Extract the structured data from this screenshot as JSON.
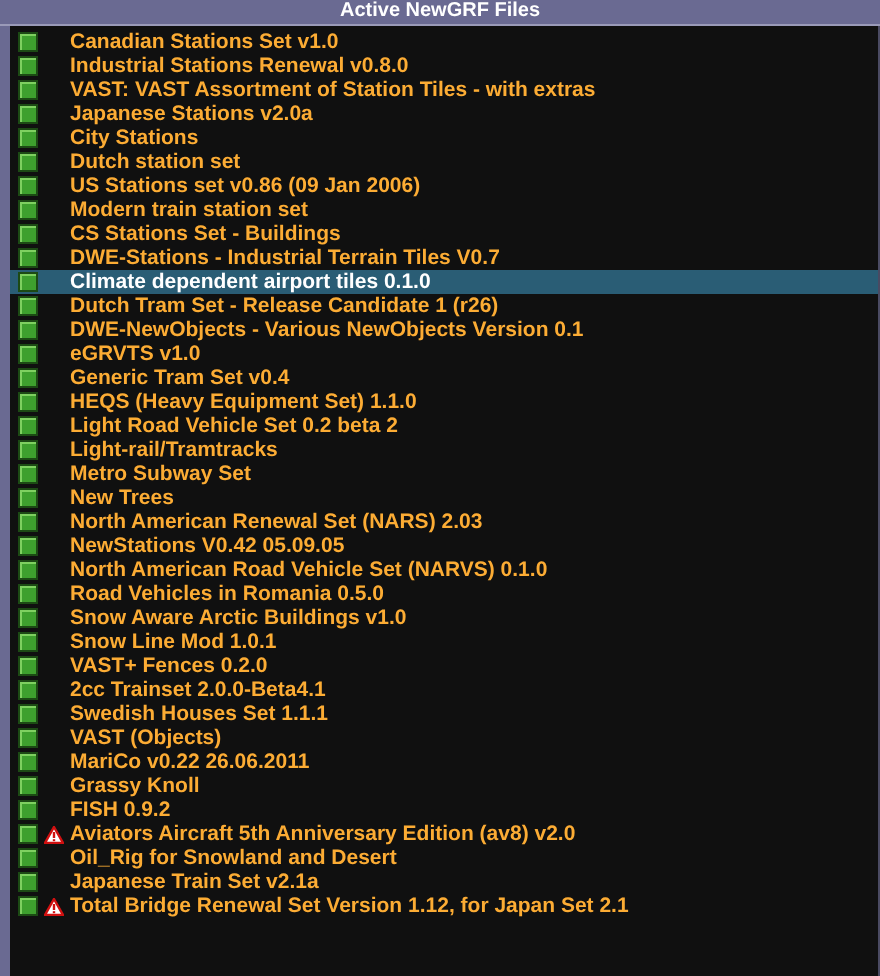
{
  "window": {
    "title": "Active NewGRF Files"
  },
  "items": [
    {
      "label": "Canadian Stations Set v1.0",
      "selected": false,
      "warning": false
    },
    {
      "label": "Industrial Stations Renewal v0.8.0",
      "selected": false,
      "warning": false
    },
    {
      "label": "VAST: VAST Assortment of Station Tiles - with extras",
      "selected": false,
      "warning": false
    },
    {
      "label": "Japanese Stations v2.0a",
      "selected": false,
      "warning": false
    },
    {
      "label": "City Stations",
      "selected": false,
      "warning": false
    },
    {
      "label": "Dutch station set",
      "selected": false,
      "warning": false
    },
    {
      "label": "US Stations set v0.86 (09 Jan 2006)",
      "selected": false,
      "warning": false
    },
    {
      "label": "Modern train station set",
      "selected": false,
      "warning": false
    },
    {
      "label": "CS Stations Set - Buildings",
      "selected": false,
      "warning": false
    },
    {
      "label": "DWE-Stations - Industrial Terrain Tiles V0.7",
      "selected": false,
      "warning": false
    },
    {
      "label": "Climate dependent airport tiles 0.1.0",
      "selected": true,
      "warning": false
    },
    {
      "label": "Dutch Tram Set - Release Candidate 1 (r26)",
      "selected": false,
      "warning": false
    },
    {
      "label": "DWE-NewObjects - Various NewObjects Version 0.1",
      "selected": false,
      "warning": false
    },
    {
      "label": "eGRVTS v1.0",
      "selected": false,
      "warning": false
    },
    {
      "label": "Generic Tram Set v0.4",
      "selected": false,
      "warning": false
    },
    {
      "label": "HEQS (Heavy Equipment Set) 1.1.0",
      "selected": false,
      "warning": false
    },
    {
      "label": "Light Road Vehicle Set 0.2 beta 2",
      "selected": false,
      "warning": false
    },
    {
      "label": "Light-rail/Tramtracks",
      "selected": false,
      "warning": false
    },
    {
      "label": "Metro Subway Set",
      "selected": false,
      "warning": false
    },
    {
      "label": "New Trees",
      "selected": false,
      "warning": false
    },
    {
      "label": "North American Renewal Set (NARS) 2.03",
      "selected": false,
      "warning": false
    },
    {
      "label": "NewStations V0.42 05.09.05",
      "selected": false,
      "warning": false
    },
    {
      "label": "North American Road Vehicle Set (NARVS) 0.1.0",
      "selected": false,
      "warning": false
    },
    {
      "label": "Road Vehicles in Romania 0.5.0",
      "selected": false,
      "warning": false
    },
    {
      "label": "Snow Aware Arctic Buildings v1.0",
      "selected": false,
      "warning": false
    },
    {
      "label": "Snow Line Mod 1.0.1",
      "selected": false,
      "warning": false
    },
    {
      "label": "VAST+ Fences 0.2.0",
      "selected": false,
      "warning": false
    },
    {
      "label": "2cc Trainset 2.0.0-Beta4.1",
      "selected": false,
      "warning": false
    },
    {
      "label": "Swedish Houses Set 1.1.1",
      "selected": false,
      "warning": false
    },
    {
      "label": "VAST (Objects)",
      "selected": false,
      "warning": false
    },
    {
      "label": "MariCo v0.22 26.06.2011",
      "selected": false,
      "warning": false
    },
    {
      "label": "Grassy Knoll",
      "selected": false,
      "warning": false
    },
    {
      "label": "FISH 0.9.2",
      "selected": false,
      "warning": false
    },
    {
      "label": "Aviators Aircraft 5th Anniversary Edition (av8) v2.0",
      "selected": false,
      "warning": true
    },
    {
      "label": "Oil_Rig for Snowland and Desert",
      "selected": false,
      "warning": false
    },
    {
      "label": "Japanese Train Set v2.1a",
      "selected": false,
      "warning": false
    },
    {
      "label": "Total Bridge Renewal Set Version 1.12, for Japan Set 2.1",
      "selected": false,
      "warning": true
    }
  ]
}
